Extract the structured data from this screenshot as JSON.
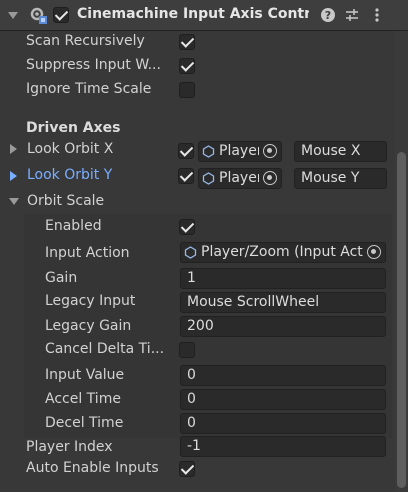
{
  "header": {
    "title": "Cinemachine Input Axis Controll",
    "enabled": true,
    "icons": [
      "foldout-arrow-icon",
      "component-gear-icon",
      "help-icon",
      "preset-icon",
      "kebab-menu-icon"
    ]
  },
  "properties": {
    "scan_recursively": {
      "label": "Scan Recursively",
      "checked": true
    },
    "suppress_input": {
      "label": "Suppress Input W...",
      "checked": true
    },
    "ignore_time_scale": {
      "label": "Ignore Time Scale",
      "checked": false
    },
    "driven_axes_label": "Driven Axes"
  },
  "axes": [
    {
      "label": "Look Orbit X",
      "checked": true,
      "action": "Player",
      "input": "Mouse X",
      "highlight": false
    },
    {
      "label": "Look Orbit Y",
      "checked": true,
      "action": "Player",
      "input": "Mouse Y",
      "highlight": true
    }
  ],
  "orbit_scale": {
    "label": "Orbit Scale",
    "enabled": {
      "label": "Enabled",
      "checked": true
    },
    "input_action": {
      "label": "Input Action",
      "value": "Player/Zoom (Input Act"
    },
    "gain": {
      "label": "Gain",
      "value": "1"
    },
    "legacy_input": {
      "label": "Legacy Input",
      "value": "Mouse ScrollWheel"
    },
    "legacy_gain": {
      "label": "Legacy Gain",
      "value": "200"
    },
    "cancel_delta_time": {
      "label": "Cancel Delta Ti...",
      "checked": false
    },
    "input_value": {
      "label": "Input Value",
      "value": "0"
    },
    "accel_time": {
      "label": "Accel Time",
      "value": "0"
    },
    "decel_time": {
      "label": "Decel Time",
      "value": "0"
    }
  },
  "player_index": {
    "label": "Player Index",
    "value": "-1"
  },
  "auto_enable_inputs": {
    "label": "Auto Enable Inputs",
    "checked": true
  },
  "colors": {
    "background": "#383838",
    "highlight_label": "#7aaeff",
    "field": "#2a2a2a"
  }
}
